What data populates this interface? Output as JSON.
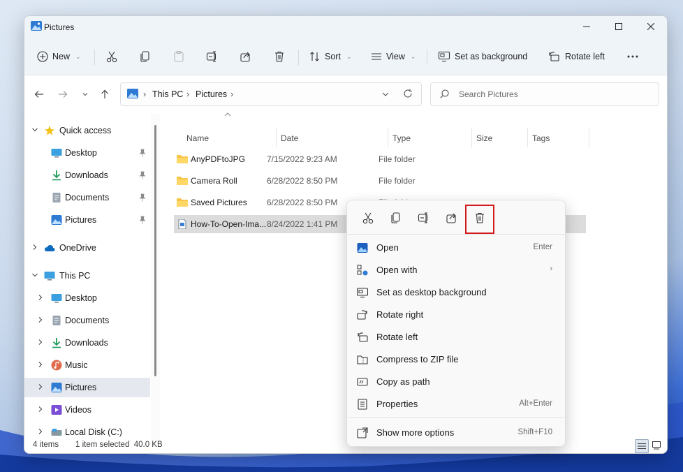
{
  "window": {
    "title": "Pictures"
  },
  "toolbar": {
    "new_label": "New",
    "sort_label": "Sort",
    "view_label": "View",
    "set_background_label": "Set as background",
    "rotate_left_label": "Rotate left"
  },
  "address": {
    "breadcrumbs": [
      "This PC",
      "Pictures"
    ]
  },
  "search": {
    "placeholder": "Search Pictures"
  },
  "sidebar": {
    "items": [
      {
        "label": "Quick access",
        "icon": "star-icon"
      },
      {
        "label": "Desktop",
        "icon": "desktop-icon"
      },
      {
        "label": "Downloads",
        "icon": "download-icon"
      },
      {
        "label": "Documents",
        "icon": "document-icon"
      },
      {
        "label": "Pictures",
        "icon": "pictures-icon"
      },
      {
        "label": "OneDrive",
        "icon": "cloud-icon"
      },
      {
        "label": "This PC",
        "icon": "computer-icon"
      },
      {
        "label": "Desktop",
        "icon": "desktop-icon"
      },
      {
        "label": "Documents",
        "icon": "document-icon"
      },
      {
        "label": "Downloads",
        "icon": "download-icon"
      },
      {
        "label": "Music",
        "icon": "music-icon"
      },
      {
        "label": "Pictures",
        "icon": "pictures-icon"
      },
      {
        "label": "Videos",
        "icon": "video-icon"
      },
      {
        "label": "Local Disk (C:)",
        "icon": "disk-icon"
      }
    ]
  },
  "columns": {
    "name": "Name",
    "date": "Date",
    "type": "Type",
    "size": "Size",
    "tags": "Tags"
  },
  "files": [
    {
      "name": "AnyPDFtoJPG",
      "date": "7/15/2022 9:23 AM",
      "type": "File folder"
    },
    {
      "name": "Camera Roll",
      "date": "6/28/2022 8:50 PM",
      "type": "File folder"
    },
    {
      "name": "Saved Pictures",
      "date": "6/28/2022 8:50 PM",
      "type": "File folder"
    },
    {
      "name": "How-To-Open-Ima...",
      "date": "8/24/2022 1:41 PM",
      "type": ""
    }
  ],
  "status": {
    "item_count": "4 items",
    "selection": "1 item selected  40.0 KB"
  },
  "context_menu": {
    "items": [
      {
        "label": "Open",
        "shortcut": "Enter"
      },
      {
        "label": "Open with",
        "shortcut": ""
      },
      {
        "label": "Set as desktop background",
        "shortcut": ""
      },
      {
        "label": "Rotate right",
        "shortcut": ""
      },
      {
        "label": "Rotate left",
        "shortcut": ""
      },
      {
        "label": "Compress to ZIP file",
        "shortcut": ""
      },
      {
        "label": "Copy as path",
        "shortcut": ""
      },
      {
        "label": "Properties",
        "shortcut": "Alt+Enter"
      },
      {
        "label": "Show more options",
        "shortcut": "Shift+F10"
      }
    ]
  },
  "colors": {
    "accent": "#0067c0",
    "highlight_box": "#d41b1b",
    "folder": "#f7c648"
  }
}
